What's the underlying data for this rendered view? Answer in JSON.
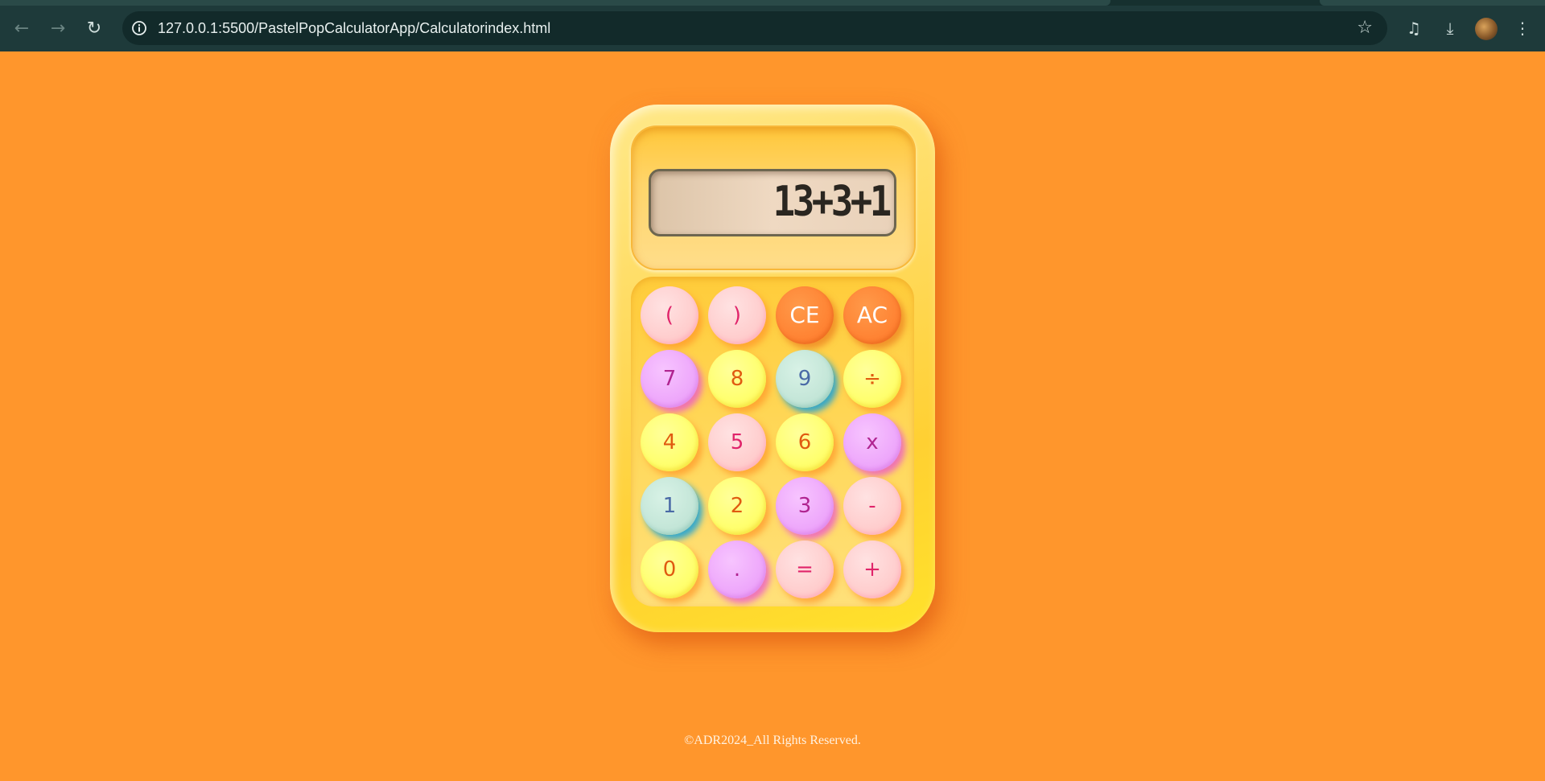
{
  "browser": {
    "url": "127.0.0.1:5500/PastelPopCalculatorApp/Calculatorindex.html",
    "back_icon": "←",
    "forward_icon": "→",
    "reload_icon": "↻",
    "star_icon": "☆",
    "media_icon": "♫",
    "download_icon": "⤓",
    "menu_icon": "⋮"
  },
  "calculator": {
    "display": "13+3+1",
    "keys": [
      {
        "label": "(",
        "color": "pink"
      },
      {
        "label": ")",
        "color": "pink"
      },
      {
        "label": "CE",
        "color": "orange"
      },
      {
        "label": "AC",
        "color": "orange"
      },
      {
        "label": "7",
        "color": "violet"
      },
      {
        "label": "8",
        "color": "yellow"
      },
      {
        "label": "9",
        "color": "mint"
      },
      {
        "label": "÷",
        "color": "yellow"
      },
      {
        "label": "4",
        "color": "yellow"
      },
      {
        "label": "5",
        "color": "pink"
      },
      {
        "label": "6",
        "color": "yellow"
      },
      {
        "label": "x",
        "color": "violet"
      },
      {
        "label": "1",
        "color": "mint"
      },
      {
        "label": "2",
        "color": "yellow"
      },
      {
        "label": "3",
        "color": "violet"
      },
      {
        "label": "-",
        "color": "pink"
      },
      {
        "label": "0",
        "color": "yellow"
      },
      {
        "label": ".",
        "color": "violet"
      },
      {
        "label": "=",
        "color": "pink"
      },
      {
        "label": "+",
        "color": "pink"
      }
    ]
  },
  "footer": {
    "copyright": "©ADR2024_All Rights Reserved."
  },
  "colors": {
    "page_background": "#ff962c",
    "browser_bar": "#1e3a3a",
    "calculator_body": "#ffd95a"
  }
}
